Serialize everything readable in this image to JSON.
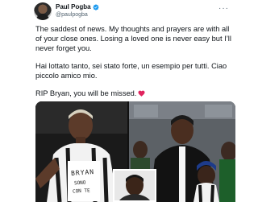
{
  "user": {
    "display_name": "Paul Pogba",
    "handle": "@paulpogba"
  },
  "tweet": {
    "paragraph_1": "The saddest of news. My thoughts and prayers are with all of your close ones. Losing a loved one is never easy but I’ll never forget you.",
    "paragraph_2": "Hai lottato tanto, sei stato forte, un esempio per tutti. Ciao piccolo amico mio.",
    "paragraph_3": "RIP Bryan, you will be missed."
  },
  "media": {
    "shirt_line_1": "BRYAN",
    "shirt_line_2": "SONO",
    "shirt_line_3": "CON TE"
  },
  "colors": {
    "text": "#0f1419",
    "secondary": "#536471",
    "verified": "#1d9bf0",
    "heart": "#e0245e"
  }
}
